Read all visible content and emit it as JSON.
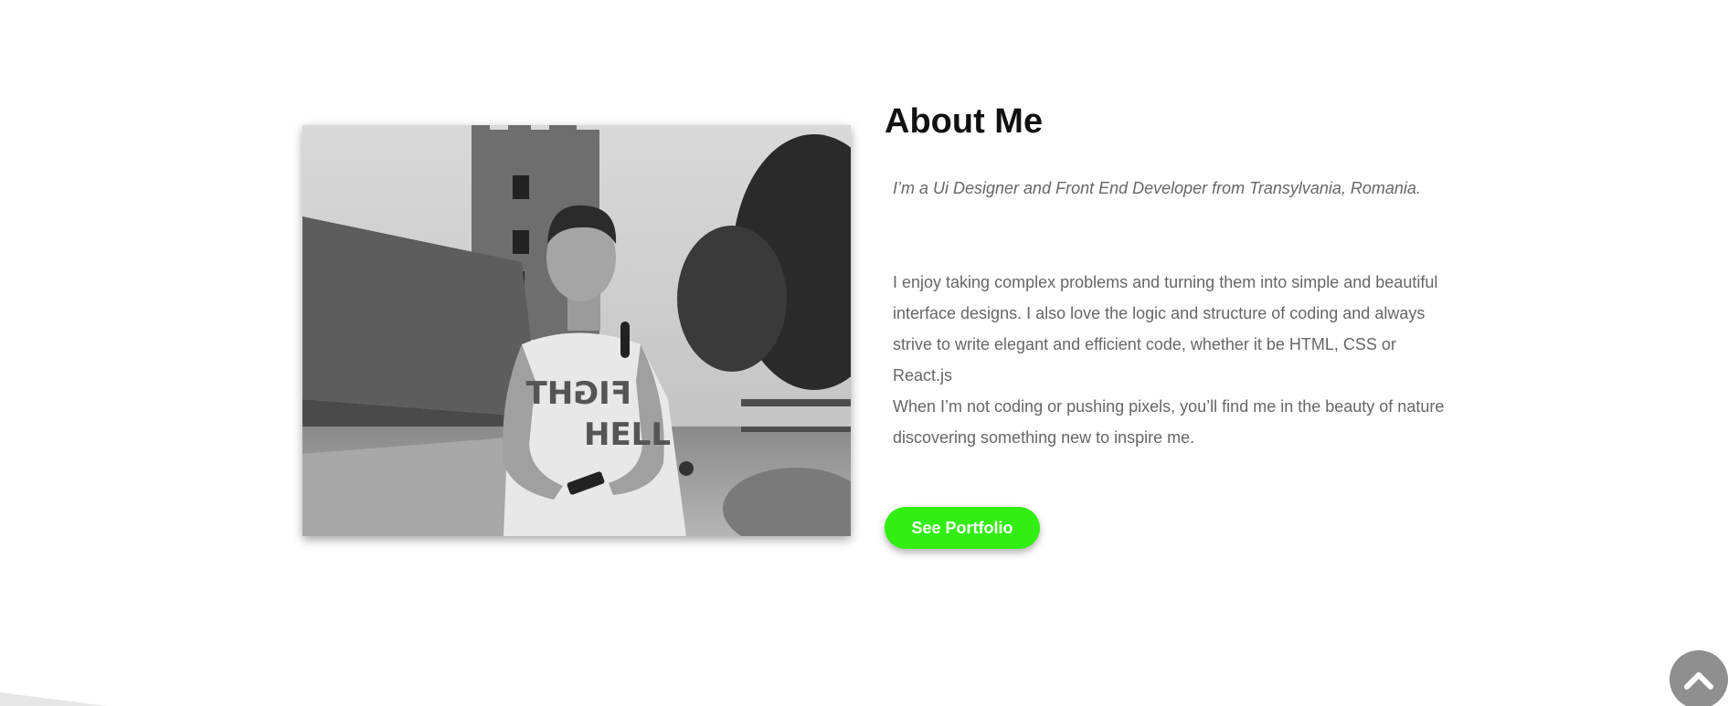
{
  "about": {
    "title": "About Me",
    "tagline": "I’m a Ui Designer and Front End Developer from Transylvania, Romania.",
    "bio_paragraph_1": "I enjoy taking complex problems and turning them into simple and beautiful interface designs. I also love the logic and structure of coding and always strive to write elegant and efficient code, whether it be HTML, CSS or React.js",
    "bio_paragraph_2": "When I’m not coding or pushing pixels, you’ll find me in the beauty of nature discovering something new to inspire me.",
    "button_label": "See Portfolio",
    "photo_shirt_text": "HELL"
  },
  "colors": {
    "accent": "#33ee11",
    "text_muted": "#666666",
    "scroll_button": "#8f8f8f"
  },
  "icons": {
    "scroll_top": "chevron-up-icon"
  }
}
